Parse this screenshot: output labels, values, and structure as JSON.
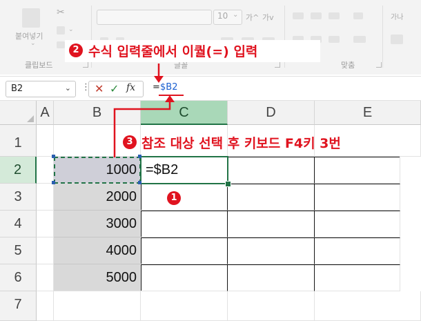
{
  "ribbon": {
    "paste_label": "붙여넣기",
    "font_size_value": "10",
    "font_grow_icon": "가^",
    "font_shrink_icon": "가v",
    "groups": [
      "클립보드",
      "글꼴",
      "맞춤"
    ],
    "wrap_label": "가나"
  },
  "formula_bar": {
    "name_box": "B2",
    "formula_eq": "=",
    "formula_ref": "$B2",
    "fx_label": "fx"
  },
  "sheet": {
    "columns": [
      "A",
      "B",
      "C",
      "D",
      "E"
    ],
    "rows": [
      "1",
      "2",
      "3",
      "4",
      "5",
      "6",
      "7"
    ],
    "b_values": [
      "1000",
      "2000",
      "3000",
      "4000",
      "5000"
    ],
    "c2_value": "=$B2"
  },
  "annotations": {
    "step1_badge": "1",
    "step2_badge": "2",
    "step2_text": "수식 입력줄에서 이퀄(=) 입력",
    "step3_badge": "3",
    "step3_text": "참조 대상 선택 후 키보드 F4키 3번"
  },
  "colors": {
    "accent": "#e0131f",
    "selected_header": "#a9d8b8",
    "cell_fill": "#d9d9d9",
    "active_green": "#217346",
    "reference_blue": "#1a5fd0"
  }
}
